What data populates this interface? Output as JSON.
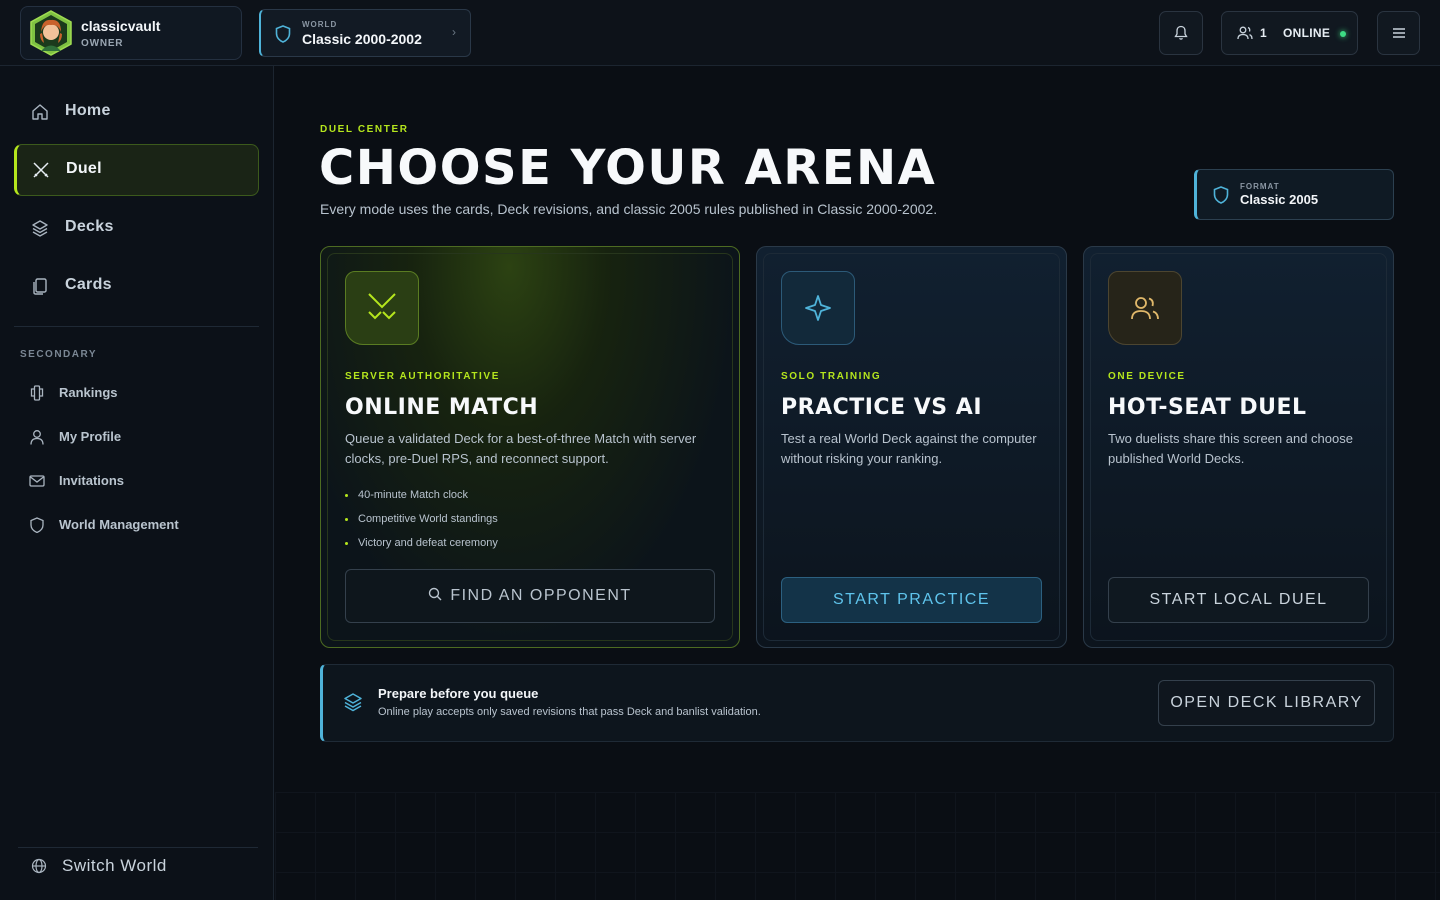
{
  "user": {
    "name": "classicvault",
    "role": "OWNER"
  },
  "world": {
    "label": "WORLD",
    "name": "Classic 2000-2002"
  },
  "topbar": {
    "online_count": "1",
    "online_label": "ONLINE"
  },
  "sidebar": {
    "primary": [
      {
        "label": "Home",
        "icon": "home-icon",
        "active": false
      },
      {
        "label": "Duel",
        "icon": "swords-icon",
        "active": true
      },
      {
        "label": "Decks",
        "icon": "layers-icon",
        "active": false
      },
      {
        "label": "Cards",
        "icon": "cards-icon",
        "active": false
      }
    ],
    "secondary_heading": "SECONDARY",
    "secondary": [
      {
        "label": "Rankings",
        "icon": "trophy-icon"
      },
      {
        "label": "My Profile",
        "icon": "user-icon"
      },
      {
        "label": "Invitations",
        "icon": "mail-icon"
      },
      {
        "label": "World Management",
        "icon": "shield-icon"
      }
    ],
    "switch_world": "Switch World"
  },
  "header": {
    "eyebrow": "DUEL CENTER",
    "title": "CHOOSE YOUR ARENA",
    "subtitle": "Every mode uses the cards, Deck revisions, and classic 2005 rules published in Classic 2000-2002.",
    "format_label": "FORMAT",
    "format_value": "Classic 2005"
  },
  "modes": [
    {
      "eyebrow": "SERVER AUTHORITATIVE",
      "title": "ONLINE MATCH",
      "description": "Queue a validated Deck for a best-of-three Match with server clocks, pre-Duel RPS, and reconnect support.",
      "features": [
        "40-minute Match clock",
        "Competitive World standings",
        "Victory and defeat ceremony"
      ],
      "button": "FIND AN OPPONENT",
      "icon": "crossed-swords-icon"
    },
    {
      "eyebrow": "SOLO TRAINING",
      "title": "PRACTICE VS AI",
      "description": "Test a real World Deck against the computer without risking your ranking.",
      "button": "START PRACTICE",
      "icon": "sparkle-icon"
    },
    {
      "eyebrow": "ONE DEVICE",
      "title": "HOT-SEAT DUEL",
      "description": "Two duelists share this screen and choose published World Decks.",
      "button": "START LOCAL DUEL",
      "icon": "users-icon"
    }
  ],
  "prep": {
    "title": "Prepare before you queue",
    "subtitle": "Online play accepts only saved revisions that pass Deck and banlist validation.",
    "button": "OPEN DECK LIBRARY"
  },
  "colors": {
    "accent_lime": "#b5e61d",
    "accent_cyan": "#4fb3d9",
    "online_green": "#3ddc84",
    "background": "#0a0e14"
  }
}
